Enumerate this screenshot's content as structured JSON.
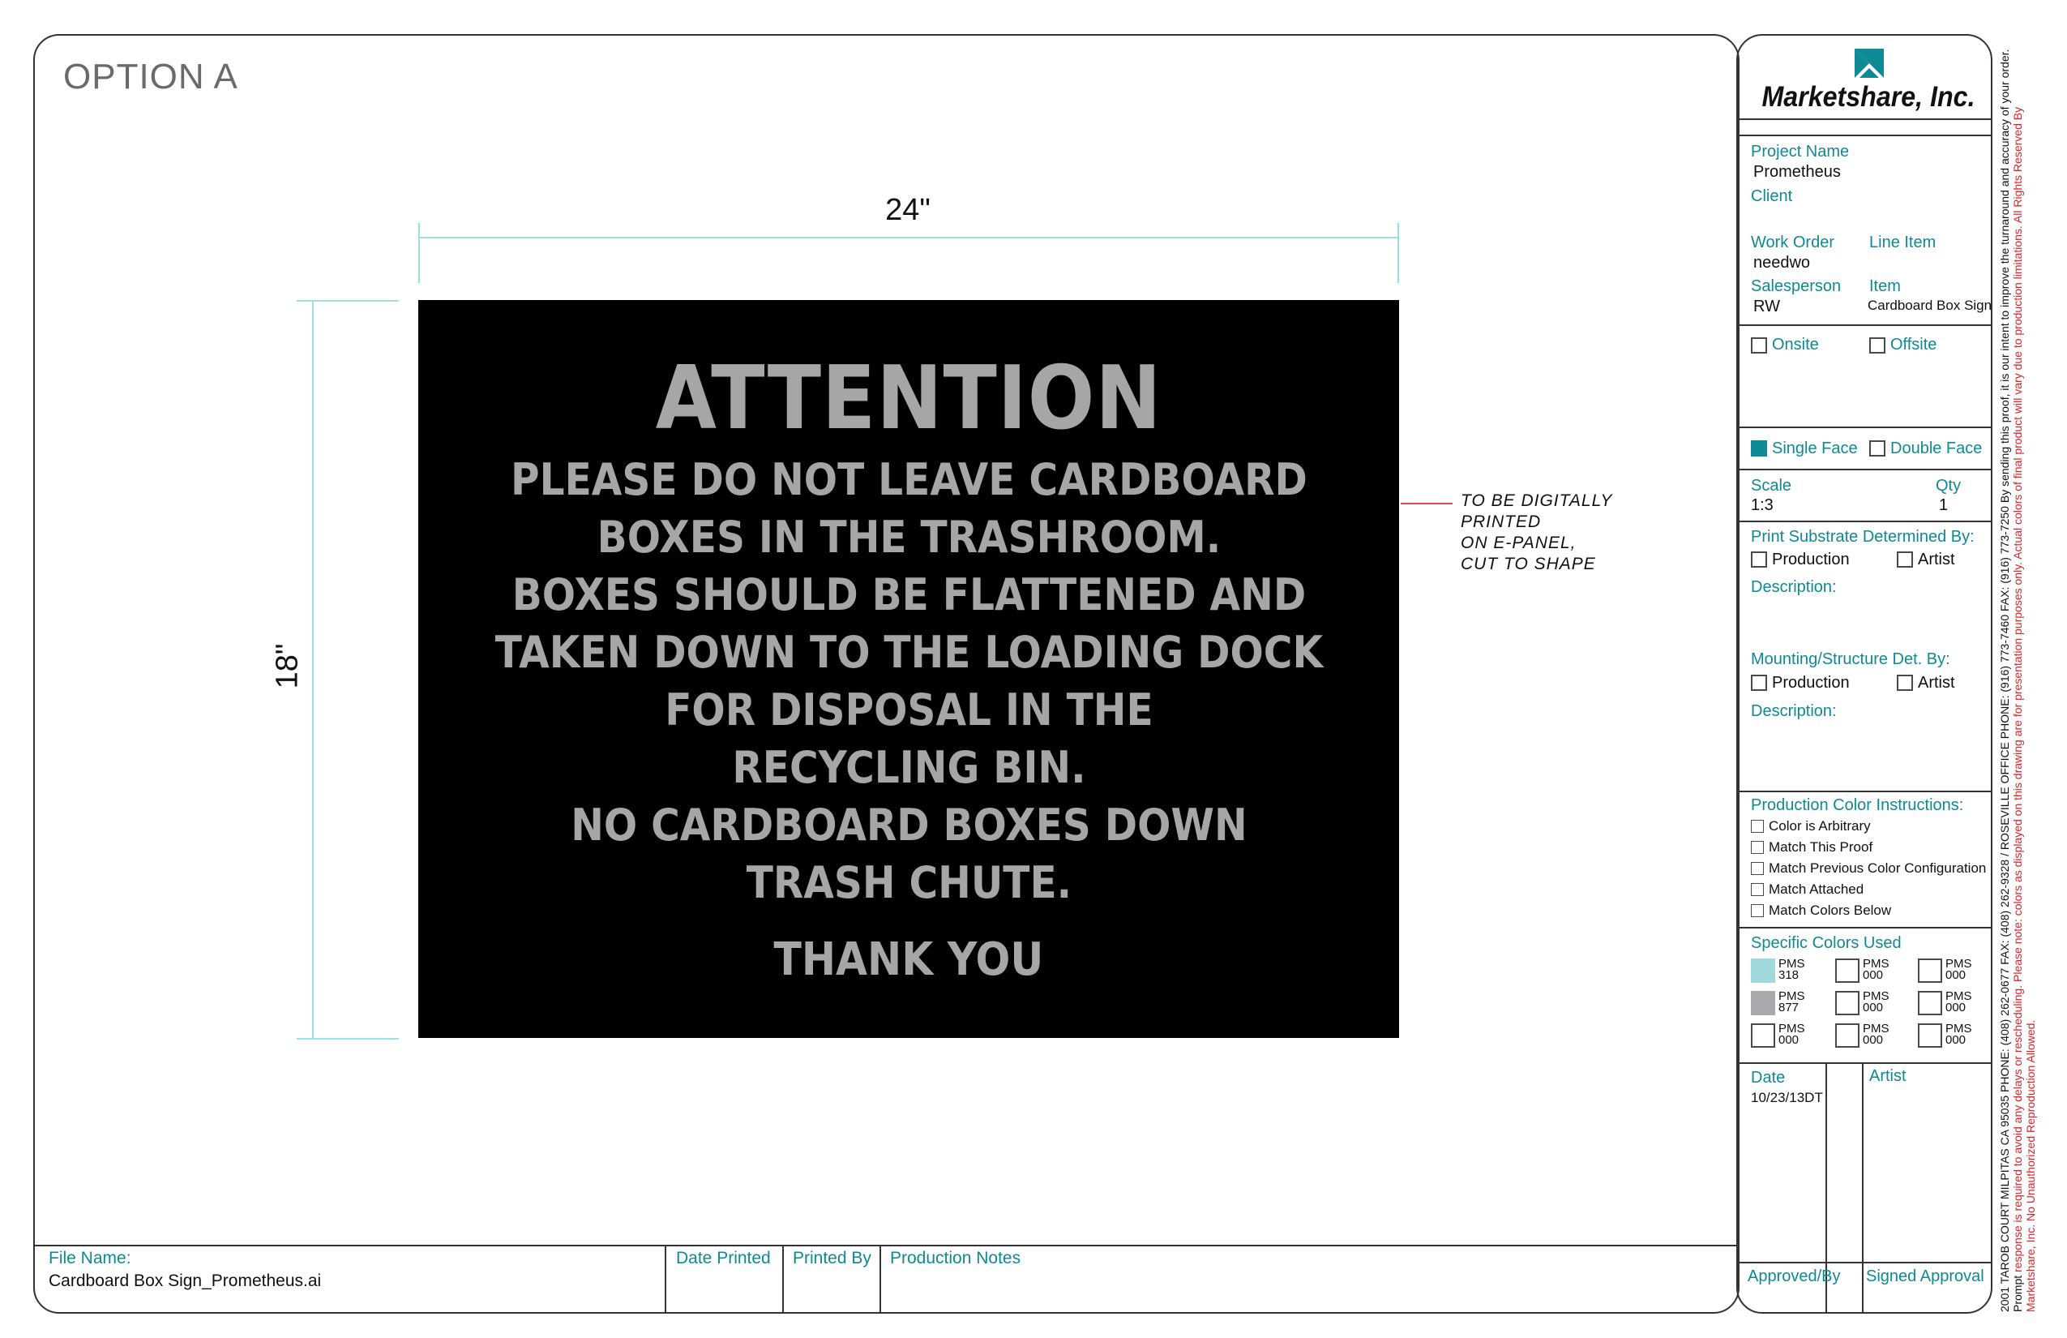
{
  "option_title": "OPTION A",
  "dimensions": {
    "width": "24\"",
    "height": "18\""
  },
  "sign": {
    "heading": "ATTENTION",
    "body_lines": [
      "PLEASE DO NOT LEAVE CARDBOARD",
      "BOXES IN THE TRASHROOM.",
      "BOXES SHOULD BE FLATTENED AND",
      "TAKEN DOWN TO THE LOADING DOCK",
      "FOR DISPOSAL IN THE",
      "RECYCLING BIN.",
      "NO CARDBOARD BOXES DOWN",
      "TRASH CHUTE."
    ],
    "thanks": "THANK YOU",
    "background_color": "#000000",
    "text_color": "#a6a6a6"
  },
  "callout": [
    "TO BE DIGITALLY",
    "PRINTED",
    "ON E-PANEL,",
    "CUT TO SHAPE"
  ],
  "bottom_strip": {
    "file_name_label": "File Name:",
    "file_name_value": "Cardboard Box Sign_Prometheus.ai",
    "date_printed_label": "Date Printed",
    "printed_by_label": "Printed By",
    "production_notes_label": "Production Notes"
  },
  "title_block": {
    "company": "Marketshare, Inc.",
    "project_name_label": "Project Name",
    "project_name_value": "Prometheus",
    "client_label": "Client",
    "work_order_label": "Work Order",
    "work_order_value": "needwo",
    "line_item_label": "Line Item",
    "salesperson_label": "Salesperson",
    "salesperson_value": "RW",
    "item_label": "Item",
    "item_value": "Cardboard Box Sign",
    "onsite_label": "Onsite",
    "offsite_label": "Offsite",
    "single_face_label": "Single Face",
    "single_face_checked": true,
    "double_face_label": "Double Face",
    "scale_label": "Scale",
    "scale_value": "1:3",
    "qty_label": "Qty",
    "qty_value": "1",
    "substrate_label": "Print Substrate Determined By:",
    "production_label": "Production",
    "artist_label": "Artist",
    "description_label": "Description:",
    "mounting_label": "Mounting/Structure Det. By:",
    "color_instructions_label": "Production Color Instructions:",
    "color_options": [
      "Color is Arbitrary",
      "Match This Proof",
      "Match Previous Color Configuration",
      "Match Attached",
      "Match Colors Below"
    ],
    "specific_colors_label": "Specific Colors Used",
    "pms_label": "PMS",
    "swatches": [
      {
        "num": "318",
        "color": "#9fd9dc"
      },
      {
        "num": "000",
        "color": "#ffffff"
      },
      {
        "num": "000",
        "color": "#ffffff"
      },
      {
        "num": "877",
        "color": "#a7a9ac"
      },
      {
        "num": "000",
        "color": "#ffffff"
      },
      {
        "num": "000",
        "color": "#ffffff"
      },
      {
        "num": "000",
        "color": "#ffffff"
      },
      {
        "num": "000",
        "color": "#ffffff"
      },
      {
        "num": "000",
        "color": "#ffffff"
      }
    ],
    "date_label": "Date",
    "date_value": "10/23/13DT",
    "artist_field_label": "Artist",
    "approved_by_label": "Approved/By",
    "signed_approval_label": "Signed Approval"
  },
  "disclaimer": {
    "black": "2001 TAROB COURT MILPITAS CA 95035  PHONE: (408) 262-0677  FAX: (408) 262-9328 / ROSEVILLE OFFICE  PHONE: (916) 773-7460  FAX: (916) 773-7250  By sending this proof, it is our intent to improve the turnaround and accuracy of your order. Prompt ",
    "red": "response is required to avoid any delays or rescheduling. Please note: colors as displayed on this drawing are for presentation purposes only.  Actual colors of final product will vary due to production limitations. All Rights Reserved By Marketshare, Inc. No Unauthorized Reproduction Allowed."
  },
  "colors": {
    "accent": "#0e8a96",
    "callout_line": "#e04a56",
    "dimension_line": "#9fdfe3"
  }
}
